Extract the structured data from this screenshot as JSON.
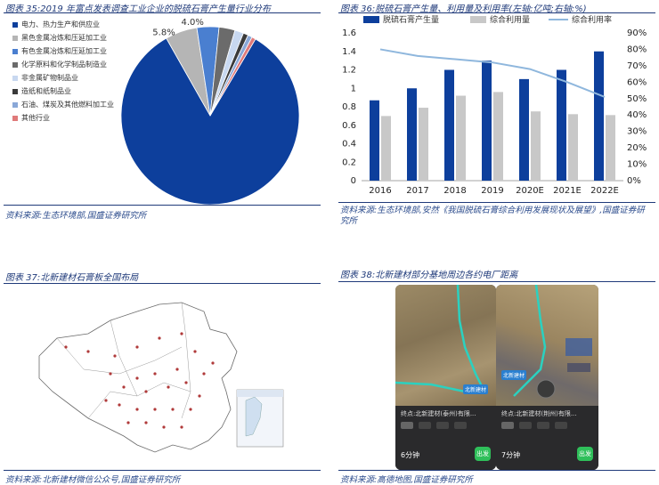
{
  "fig35": {
    "title": "图表 35:2019 年富点发表调查工业企业的脱硫石膏产生量行业分布",
    "source": "资料来源:生态环境部,国盛证券研究所",
    "legend": [
      {
        "label": "电力、热力生产和供应业",
        "color": "#0d3f9c"
      },
      {
        "label": "黑色金属冶炼和压延加工业",
        "color": "#b5b5b5"
      },
      {
        "label": "有色金属冶炼和压延加工业",
        "color": "#4a7fd0"
      },
      {
        "label": "化学原料和化学制品制造业",
        "color": "#6b6b6b"
      },
      {
        "label": "非金属矿物制品业",
        "color": "#c8d8f0"
      },
      {
        "label": "造纸和纸制品业",
        "color": "#3a3a3a"
      },
      {
        "label": "石油、煤炭及其他燃料加工业",
        "color": "#8aa8d8"
      },
      {
        "label": "其他行业",
        "color": "#e07a7a"
      }
    ],
    "data_labels": [
      "83.3%",
      "5.8%",
      "4.0%"
    ]
  },
  "fig36": {
    "title": "图表 36:脱硫石膏产生量、利用量及利用率(左轴:亿吨;右轴:%)",
    "source": "资料来源:生态环境部,安然《我国脱硫石膏综合利用发展现状及展望》,国盛证券研究所"
  },
  "fig37": {
    "title": "图表 37:北新建材石膏板全国布局",
    "source": "资料来源:北新建材微信公众号,国盛证券研究所"
  },
  "fig38": {
    "title": "图表 38:北新建材部分基地周边各约电厂距离",
    "source": "资料来源:高德地图,国盛证券研究所",
    "phones": [
      {
        "endpoint": "终点:北新建材(泰州)有限...",
        "time": "6分钟",
        "go": "出发",
        "map_label": "北新建材"
      },
      {
        "endpoint": "终点:北新建材(荆州)有限...",
        "time": "7分钟",
        "go": "出发",
        "map_label": "北新建材"
      }
    ]
  },
  "chart_data": [
    {
      "type": "pie",
      "categories": [
        "电力、热力生产和供应业",
        "黑色金属冶炼和压延加工业",
        "有色金属冶炼和压延加工业",
        "化学原料和化学制品制造业",
        "非金属矿物制品业",
        "造纸和纸制品业",
        "石油、煤炭及其他燃料加工业",
        "其他行业"
      ],
      "values": [
        83.3,
        5.8,
        4.0,
        2.9,
        1.6,
        0.9,
        0.8,
        0.7
      ],
      "colors": [
        "#0d3f9c",
        "#b5b5b5",
        "#4a7fd0",
        "#6b6b6b",
        "#c8d8f0",
        "#3a3a3a",
        "#8aa8d8",
        "#e07a7a"
      ],
      "legend": "left"
    },
    {
      "type": "bar",
      "categories": [
        "2016",
        "2017",
        "2018",
        "2019",
        "2020E",
        "2021E",
        "2022E"
      ],
      "series": [
        {
          "name": "脱硫石膏产生量",
          "type": "bar",
          "axis": "left",
          "color": "#0d3f9c",
          "values": [
            0.87,
            1.0,
            1.2,
            1.3,
            1.1,
            1.2,
            1.4
          ]
        },
        {
          "name": "综合利用量",
          "type": "bar",
          "axis": "left",
          "color": "#c8c8c8",
          "values": [
            0.7,
            0.79,
            0.92,
            0.96,
            0.75,
            0.72,
            0.71
          ]
        },
        {
          "name": "综合利用率",
          "type": "line",
          "axis": "right",
          "color": "#8fb7dd",
          "values": [
            80,
            76,
            74,
            72,
            68,
            60,
            51
          ]
        }
      ],
      "ylim": [
        0,
        1.6
      ],
      "yticks": [
        "0",
        "0.2",
        "0.4",
        "0.6",
        "0.8",
        "1",
        "1.2",
        "1.4",
        "1.6"
      ],
      "y2lim": [
        0,
        90
      ],
      "y2ticks": [
        "0%",
        "10%",
        "20%",
        "30%",
        "40%",
        "50%",
        "60%",
        "70%",
        "80%",
        "90%"
      ],
      "legend": "top"
    }
  ]
}
